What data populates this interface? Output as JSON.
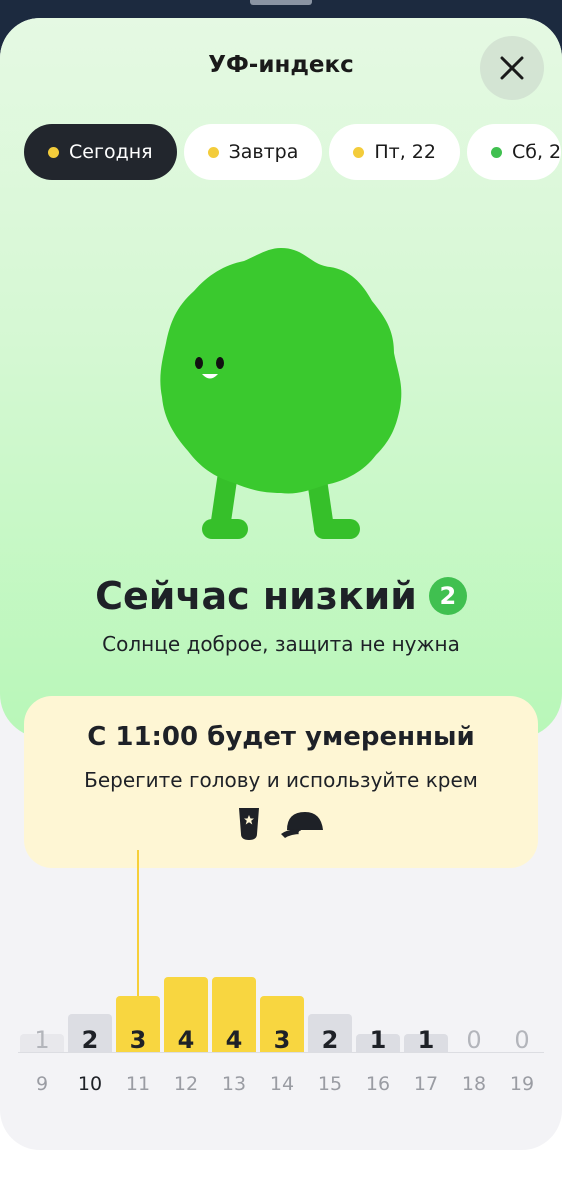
{
  "title": "УФ-индекс",
  "tabs": [
    {
      "label": "Сегодня",
      "dot": "#f3cc3b",
      "active": true
    },
    {
      "label": "Завтра",
      "dot": "#f3cc3b"
    },
    {
      "label": "Пт, 22",
      "dot": "#f3cc3b"
    },
    {
      "label": "Сб, 2",
      "dot": "#40c050"
    }
  ],
  "current": {
    "headline": "Сейчас низкий",
    "index": "2",
    "advice": "Солнце доброе, защита не нужна"
  },
  "notice": {
    "title": "С 11:00 будет умеренный",
    "text": "Берегите голову и используйте крем",
    "icons": [
      "sunscreen-icon",
      "cap-icon"
    ]
  },
  "hourly": [
    {
      "hour": "9",
      "uv": "1"
    },
    {
      "hour": "10",
      "uv": "2"
    },
    {
      "hour": "11",
      "uv": "3"
    },
    {
      "hour": "12",
      "uv": "4"
    },
    {
      "hour": "13",
      "uv": "4"
    },
    {
      "hour": "14",
      "uv": "3"
    },
    {
      "hour": "15",
      "uv": "2"
    },
    {
      "hour": "16",
      "uv": "1"
    },
    {
      "hour": "17",
      "uv": "1"
    },
    {
      "hour": "18",
      "uv": "0"
    },
    {
      "hour": "19",
      "uv": "0"
    }
  ],
  "colors": {
    "low": "#40c050",
    "moderate": "#f8d640",
    "bar_grey": "#dcdde3",
    "bar_light": "#e8e8ec"
  }
}
